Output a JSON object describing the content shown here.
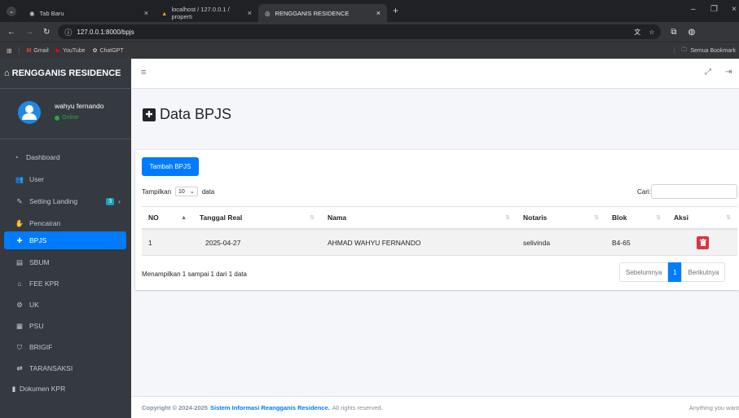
{
  "browser": {
    "tabs": [
      {
        "label": "Tab Baru"
      },
      {
        "label": "localhost / 127.0.0.1 / properti"
      },
      {
        "label": "RENGGANIS RESIDENCE"
      }
    ],
    "address": "127.0.0.1:8000/bpjs",
    "bookmarks": [
      "Gmail",
      "YouTube",
      "ChatGPT"
    ],
    "all_bookmarks": "Semua Bookmark"
  },
  "brand": "RENGGANIS RESIDENCE",
  "user": {
    "name": "wahyu fernando",
    "status": "Online"
  },
  "nav": [
    {
      "label": "Dashboard",
      "icon": "tachometer-icon"
    },
    {
      "label": "User",
      "icon": "users-icon"
    },
    {
      "label": "Setting Landing",
      "icon": "edit-icon",
      "badge": "3"
    },
    {
      "label": "Pencairan",
      "icon": "hand-holding-icon"
    },
    {
      "label": "BPJS",
      "icon": "medkit-icon"
    },
    {
      "label": "SBUM",
      "icon": "document-icon"
    },
    {
      "label": "FEE KPR",
      "icon": "home-icon"
    },
    {
      "label": "UK",
      "icon": "cogs-icon"
    },
    {
      "label": "PSU",
      "icon": "building-icon"
    },
    {
      "label": "BRIGIF",
      "icon": "shield-icon"
    },
    {
      "label": "TARANSAKSI",
      "icon": "exchange-icon"
    },
    {
      "label": "Dokumen KPR",
      "icon": "file-icon"
    }
  ],
  "page_title": "Data BPJS",
  "add_button": "Tambah BPJS",
  "length": {
    "prefix": "Tampilkan",
    "value": "10",
    "suffix": "data"
  },
  "search_label": "Cari:",
  "table": {
    "headers": [
      "NO",
      "Tanggal Real",
      "Nama",
      "Notaris",
      "Blok",
      "Aksi"
    ],
    "rows": [
      [
        "1",
        "2025-04-27",
        "AHMAD WAHYU FERNANDO",
        "selivinda",
        "B4-65"
      ]
    ]
  },
  "info": "Menampilkan 1 sampai 1 dari 1 data",
  "pagination": {
    "prev": "Sebelumnya",
    "current": "1",
    "next": "Berikutnya"
  },
  "footer": {
    "prefix": "Copyright © 2024-2025",
    "link": "Sistem Informasi Reangganis Residence.",
    "suffix": "All rights reserved.",
    "right": "Anything you want"
  },
  "colors": {
    "primary": "#007bff",
    "danger": "#dc3545",
    "sidebar": "#343a40",
    "online": "#28a745"
  }
}
